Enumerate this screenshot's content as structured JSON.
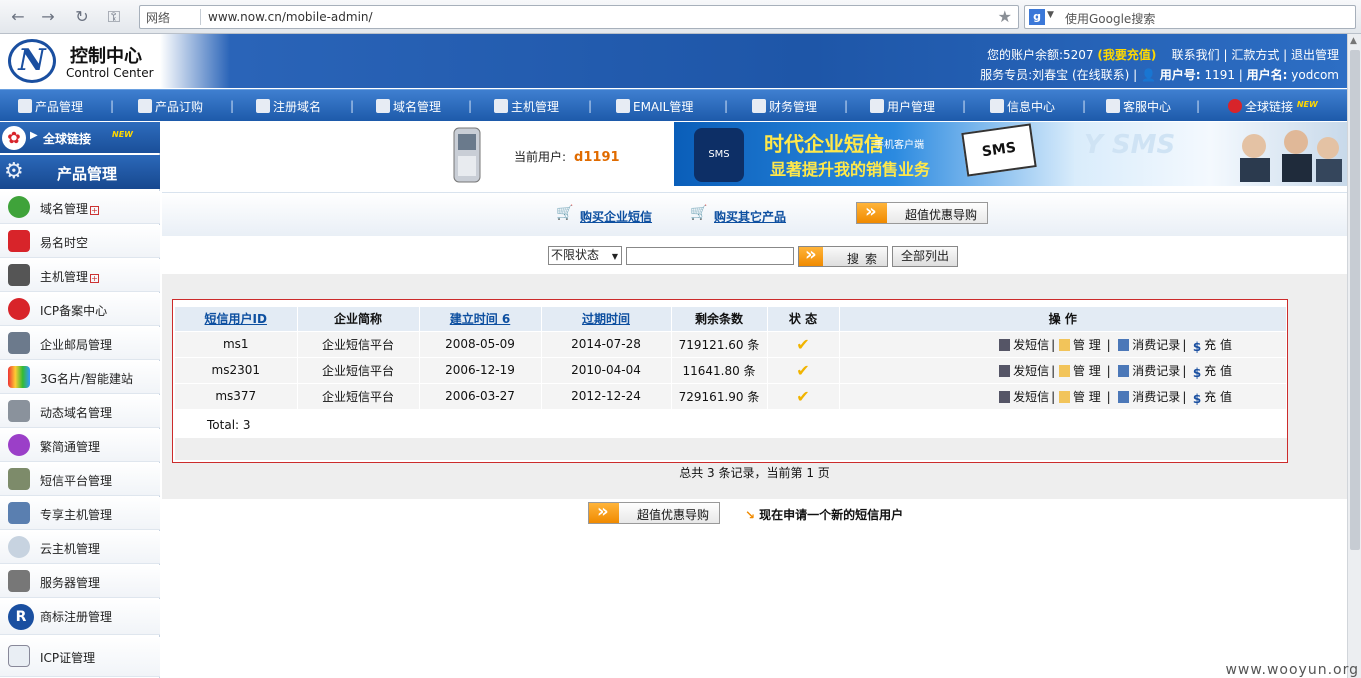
{
  "browser": {
    "network_label": "网络",
    "url": "www.now.cn/mobile-admin/",
    "search_placeholder": "使用Google搜索"
  },
  "header": {
    "logo_cn": "控制中心",
    "logo_en": "Control Center",
    "balance_text": "您的账户余额:5207",
    "recharge": "(我要充值)",
    "links": "联系我们 | 汇款方式 | 退出管理",
    "service_text": "服务专员:刘春宝 (在线联系) |",
    "user_no_label": "用户号:",
    "user_no": "1191",
    "user_name_label": "用户名:",
    "user_name": "yodcom"
  },
  "mainnav": {
    "items": [
      {
        "label": "产品管理",
        "icon": "product-icon"
      },
      {
        "label": "产品订购",
        "icon": "cart-icon"
      },
      {
        "label": "注册域名",
        "icon": "domain-reg-icon"
      },
      {
        "label": "域名管理",
        "icon": "globe-icon"
      },
      {
        "label": "主机管理",
        "icon": "server-icon"
      },
      {
        "label": "EMAIL管理",
        "icon": "mail-icon"
      },
      {
        "label": "财务管理",
        "icon": "coins-icon"
      },
      {
        "label": "用户管理",
        "icon": "user-card-icon"
      },
      {
        "label": "信息中心",
        "icon": "doc-icon"
      },
      {
        "label": "客服中心",
        "icon": "people-icon"
      },
      {
        "label": "全球链接",
        "icon": "global-icon"
      }
    ],
    "new_tag": "NEW"
  },
  "sidebar": {
    "global_label": "全球链接",
    "new_tag": "NEW",
    "title": "产品管理",
    "items": [
      {
        "label": "域名管理",
        "has_plus": true
      },
      {
        "label": "易名时空",
        "has_plus": false
      },
      {
        "label": "主机管理",
        "has_plus": true
      },
      {
        "label": "ICP备案中心",
        "has_plus": false
      },
      {
        "label": "企业邮局管理",
        "has_plus": false
      },
      {
        "label": "3G名片/智能建站",
        "has_plus": false
      },
      {
        "label": "动态域名管理",
        "has_plus": false
      },
      {
        "label": "繁简通管理",
        "has_plus": false
      },
      {
        "label": "短信平台管理",
        "has_plus": false
      },
      {
        "label": "专享主机管理",
        "has_plus": false
      },
      {
        "label": "云主机管理",
        "has_plus": false
      },
      {
        "label": "服务器管理",
        "has_plus": false
      },
      {
        "label": "商标注册管理",
        "has_plus": false
      },
      {
        "label": "ICP证管理",
        "has_plus": false
      }
    ]
  },
  "banner": {
    "current_user_label": "当前用户:",
    "current_user": "d1191",
    "ad_title": "时代企业短信",
    "ad_small": "手机客户端",
    "ad_slogan": "显著提升我的销售业务",
    "ad_sms": "SMS",
    "ad2_text": "Y SMS"
  },
  "actions": {
    "buy_sms": "购买企业短信",
    "buy_other": "购买其它产品",
    "guide": "超值优惠导购"
  },
  "search": {
    "status_option": "不限状态",
    "search_btn": "搜索",
    "list_all_btn": "全部列出"
  },
  "table": {
    "headers": [
      "短信用户ID",
      "企业简称",
      "建立时间 6",
      "过期时间",
      "剩余条数",
      "状 态",
      "操 作"
    ],
    "rows": [
      {
        "id": "ms1",
        "name": "企业短信平台",
        "created": "2008-05-09",
        "expires": "2014-07-28",
        "remaining": "719121.60 条"
      },
      {
        "id": "ms2301",
        "name": "企业短信平台",
        "created": "2006-12-19",
        "expires": "2010-04-04",
        "remaining": "11641.80 条"
      },
      {
        "id": "ms377",
        "name": "企业短信平台",
        "created": "2006-03-27",
        "expires": "2012-12-24",
        "remaining": "729161.90 条"
      }
    ],
    "ops": {
      "send": "发短信",
      "manage": "管 理",
      "records": "消费记录",
      "recharge": "充 值"
    },
    "total": "Total: 3"
  },
  "pager": "总共 3 条记录，当前第 1 页",
  "bottom": {
    "guide": "超值优惠导购",
    "apply": "现在申请一个新的短信用户"
  },
  "watermark": "www.wooyun.org"
}
